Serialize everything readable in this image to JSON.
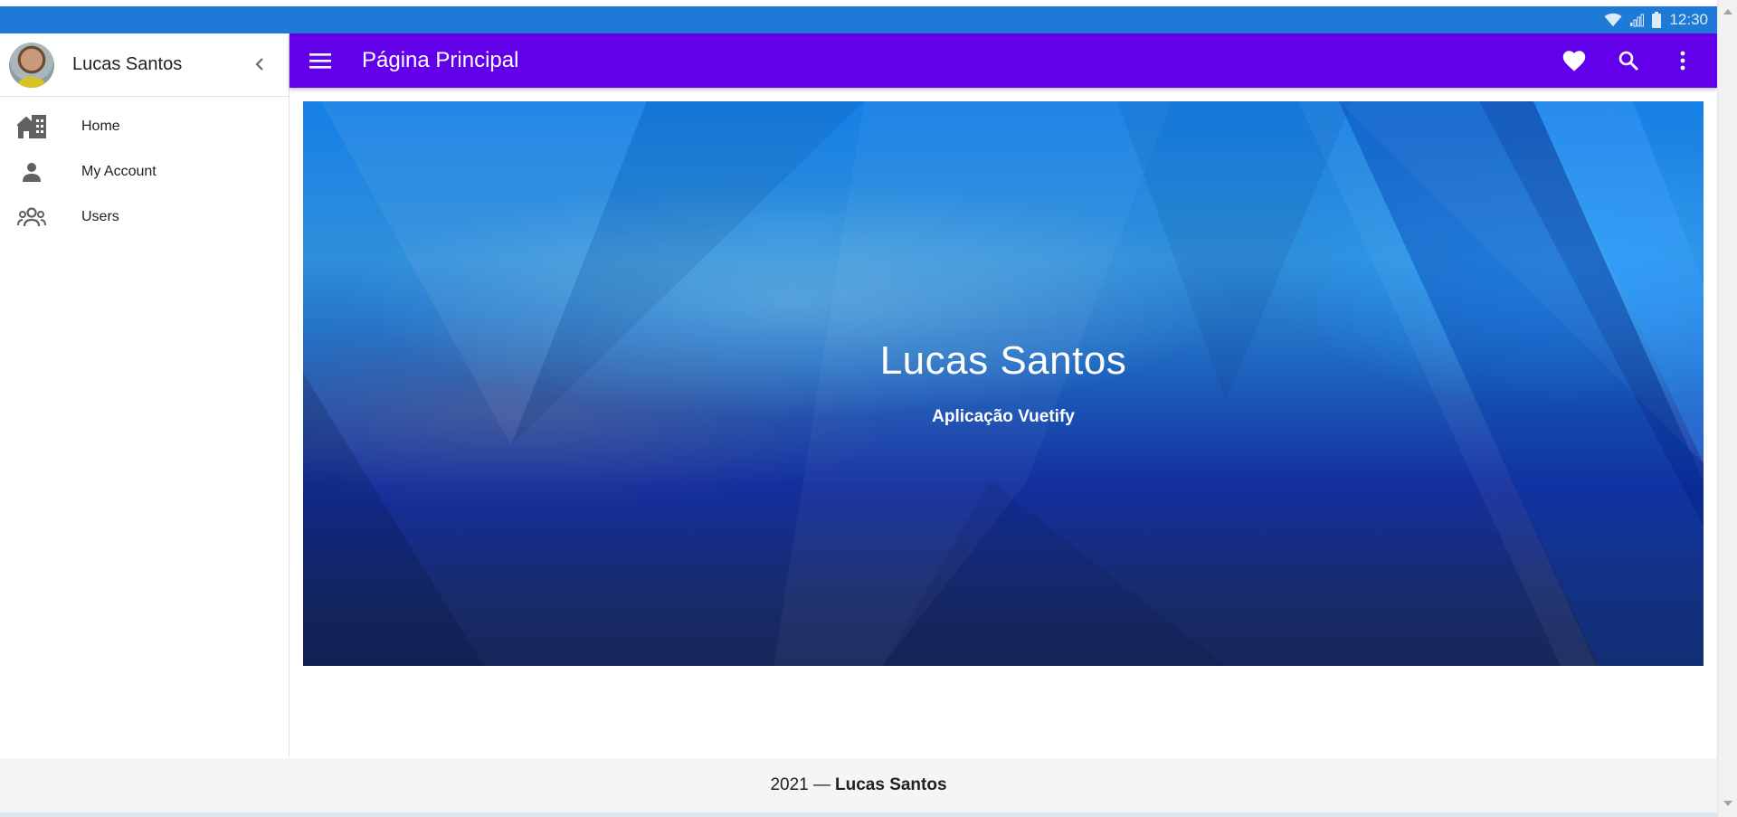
{
  "system_bar": {
    "time": "12:30",
    "icons": [
      "wifi-icon",
      "signal-icon",
      "battery-icon"
    ]
  },
  "drawer": {
    "user_name": "Lucas Santos",
    "items": [
      {
        "label": "Home",
        "icon": "home-city-icon"
      },
      {
        "label": "My Account",
        "icon": "account-icon"
      },
      {
        "label": "Users",
        "icon": "account-group-icon"
      }
    ]
  },
  "app_bar": {
    "title": "Página Principal",
    "actions": [
      "heart-icon",
      "search-icon",
      "dots-vertical-icon"
    ]
  },
  "hero": {
    "title": "Lucas Santos",
    "subtitle": "Aplicação Vuetify"
  },
  "footer": {
    "year": "2021 —",
    "author": "Lucas Santos"
  },
  "colors": {
    "system_bar": "#1e7ad6",
    "app_bar": "#6200ea",
    "footer": "#f5f5f5",
    "icon_gray": "#616161"
  }
}
